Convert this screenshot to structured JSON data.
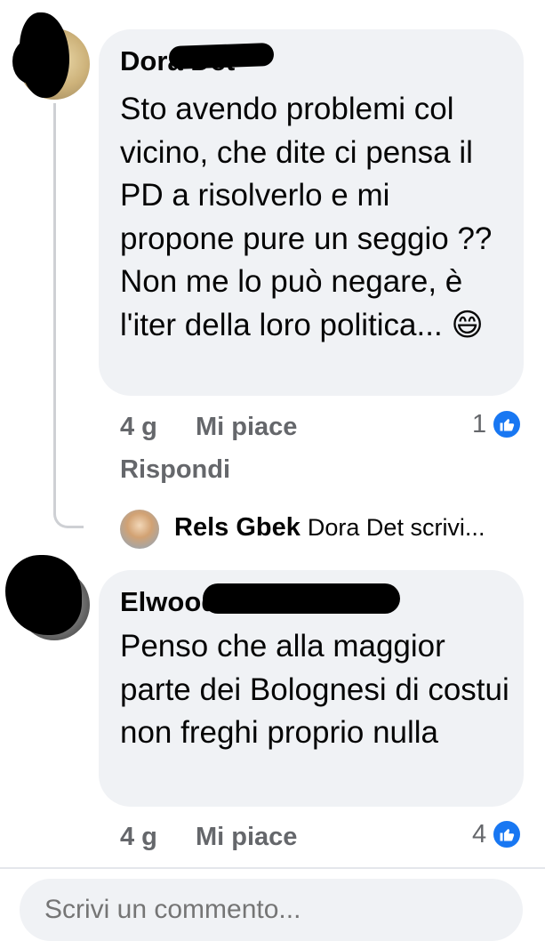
{
  "comments": [
    {
      "author": "Dora Det",
      "text": "Sto avendo problemi col vicino, che dite ci pensa il PD a risolverlo e mi propone pure un seggio ?? Non me lo può negare, è l'iter della loro politica... 😄",
      "age": "4 g",
      "like_label": "Mi piace",
      "reply_label": "Rispondi",
      "reaction_count": "1"
    },
    {
      "author": "Elwood",
      "text": "Penso che alla maggior parte dei Bolognesi di costui non freghi proprio nulla",
      "age": "4 g",
      "like_label": "Mi piace",
      "reaction_count": "4"
    }
  ],
  "reply_preview": {
    "author": "Rels Gbek",
    "snippet": "Dora Det scrivi..."
  },
  "composer": {
    "placeholder": "Scrivi un commento..."
  },
  "colors": {
    "bubble": "#f0f2f5",
    "meta": "#65676b",
    "like_blue": "#1877f2"
  },
  "icons": [
    "like-thumb-icon",
    "grinning-emoji-icon"
  ]
}
